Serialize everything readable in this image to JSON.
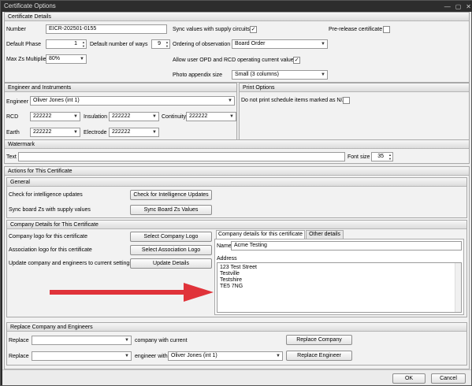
{
  "window": {
    "title": "Certificate Options",
    "buttons": [
      "—",
      "▢",
      "✕"
    ]
  },
  "cert": {
    "header": "Certificate Details",
    "number_label": "Number",
    "number_value": "EICR-202501-0155",
    "default_phase_label": "Default Phase",
    "default_phase_value": "1",
    "default_ways_label": "Default number of ways",
    "default_ways_value": "9",
    "max_zs_label": "Max Zs Multiplie",
    "max_zs_value": "80%",
    "sync_label": "Sync values with supply circuits",
    "sync_checked": "✓",
    "ordering_label": "Ordering of observation",
    "ordering_value": "Board Order",
    "allow_label": "Allow user OPD and RCD operating current values",
    "allow_checked": "✓",
    "photo_label": "Photo appendix size",
    "photo_value": "Small (3 columns)",
    "prerelease_label": "Pre-release certificate",
    "prerelease_checked": ""
  },
  "engineer": {
    "header": "Engineer and Instruments",
    "engineer_label": "Engineer",
    "engineer_value": "Oliver Jones (int 1)",
    "rcd_label": "RCD",
    "rcd_value": "222222",
    "insulation_label": "Insulation",
    "insulation_value": "222222",
    "continuity_label": "Continuity",
    "continuity_value": "222222",
    "earth_label": "Earth",
    "earth_value": "222222",
    "electrode_label": "Electrode",
    "electrode_value": "222222"
  },
  "print": {
    "header": "Print Options",
    "na_label": "Do not print schedule items marked as N/A",
    "na_checked": ""
  },
  "watermark": {
    "header": "Watermark",
    "text_label": "Text",
    "text_value": "",
    "fontsize_label": "Font size",
    "fontsize_value": "35"
  },
  "actions": {
    "header": "Actions for This Certificate"
  },
  "general": {
    "header": "General",
    "check_label": "Check for intelligence updates",
    "check_button": "Check for Intelligence Updates",
    "sync_label": "Sync board Zs with supply values",
    "sync_button": "Sync Board Zs Values"
  },
  "company": {
    "header": "Company Details for This Certificate",
    "logo_label": "Company logo for this certificate",
    "logo_button": "Select Company Logo",
    "assoc_label": "Association logo for this certificate",
    "assoc_button": "Select Association Logo",
    "update_label": "Update company and engineers to current settings",
    "update_button": "Update Details",
    "tab_company": "Company details for this certificate",
    "tab_other": "Other details",
    "name_label": "Name",
    "name_value": "Acme Testing",
    "address_label": "Address",
    "address_lines": [
      "123 Test Street",
      "Testville",
      "Testshire",
      "TE5 7NG"
    ]
  },
  "replace": {
    "header": "Replace Company and Engineers",
    "replace1_label": "Replace",
    "replace1_value": "",
    "with_current_label": "company with current",
    "replace_company_button": "Replace Company",
    "replace2_label": "Replace",
    "replace2_value": "",
    "engineer_with_label": "engineer with",
    "engineer_with_value": "Oliver Jones (int 1)",
    "replace_engineer_button": "Replace Engineer"
  },
  "footer": {
    "ok": "OK",
    "cancel": "Cancel"
  },
  "colors": {
    "arrow": "#e0333a"
  }
}
